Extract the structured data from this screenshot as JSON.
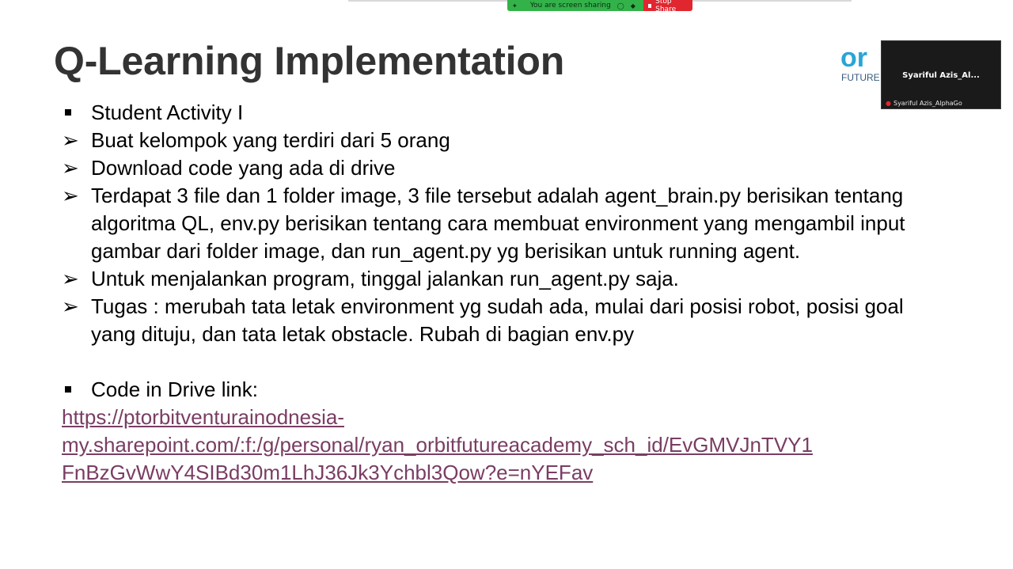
{
  "share_bar": {
    "status_text": "You are screen sharing",
    "stop_label": "Stop Share"
  },
  "slide": {
    "title": "Q-Learning Implementation",
    "items": [
      {
        "bullet": "square",
        "text": "Student Activity I"
      },
      {
        "bullet": "arrow",
        "text": "Buat kelompok yang terdiri dari 5 orang"
      },
      {
        "bullet": "arrow",
        "text": "Download code yang ada di drive"
      },
      {
        "bullet": "arrow",
        "text": "Terdapat 3 file dan 1 folder image, 3 file tersebut adalah agent_brain.py berisikan tentang algoritma QL, env.py berisikan tentang cara membuat environment yang mengambil input gambar dari folder image, dan run_agent.py yg berisikan untuk running agent."
      },
      {
        "bullet": "arrow",
        "text": "Untuk menjalankan program, tinggal jalankan run_agent.py saja."
      },
      {
        "bullet": "arrow",
        "text": "Tugas : merubah tata letak environment yg sudah ada, mulai dari posisi robot, posisi goal yang dituju, dan tata letak obstacle. Rubah di bagian env.py"
      }
    ],
    "drive_label": "Code in Drive link:",
    "link_lines": [
      "https://ptorbitventurainodnesia-",
      "my.sharepoint.com/:f:/g/personal/ryan_orbitfutureacademy_sch_id/EvGMVJnTVY1",
      "FnBzGvWwY4SIBd30m1LhJ36Jk3Ychbl3Qow?e=nYEFav"
    ]
  },
  "logo": {
    "mark": "or",
    "word": "FUTURE"
  },
  "video_tile": {
    "display_name": "Syariful  Azis_Al...",
    "label": "Syariful Azis_AlphaGo"
  },
  "colors": {
    "share_green": "#33b24a",
    "stop_red": "#e0262f",
    "link": "#7a3d63",
    "title": "#333333",
    "logo_blue": "#29a5d6"
  },
  "icons": [
    "shield-icon",
    "stop-square-icon",
    "arrow-bullet-icon",
    "square-bullet-icon",
    "mic-muted-icon"
  ]
}
